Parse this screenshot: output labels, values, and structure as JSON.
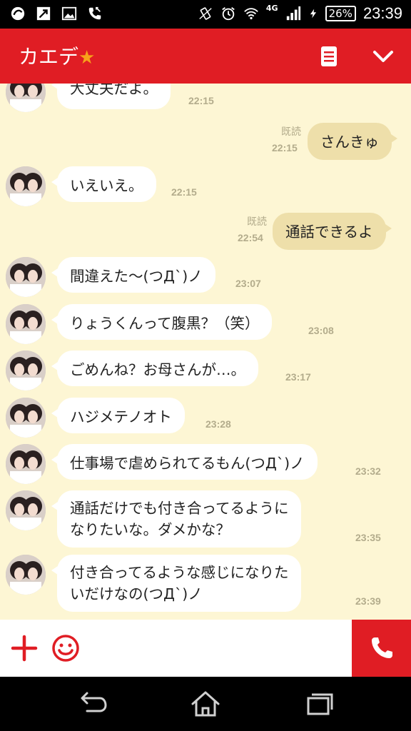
{
  "status_bar": {
    "network": "4G",
    "battery": "26%",
    "time": "23:39"
  },
  "header": {
    "contact_name": "カエデ",
    "star": "★",
    "icons": [
      "notes-icon",
      "chevron-down-icon"
    ]
  },
  "messages": [
    {
      "side": "in",
      "lines": [
        "大丈夫だよ。"
      ],
      "time": "22:15"
    },
    {
      "side": "out",
      "lines": [
        "さんきゅ"
      ],
      "read": "既読",
      "time": "22:15"
    },
    {
      "side": "in",
      "lines": [
        "いえいえ。"
      ],
      "time": "22:15"
    },
    {
      "side": "out",
      "lines": [
        "通話できるよ"
      ],
      "read": "既読",
      "time": "22:54"
    },
    {
      "side": "in",
      "lines": [
        "間違えた〜(つД`)ノ"
      ],
      "time": "23:07"
    },
    {
      "side": "in",
      "lines": [
        "りょうくんって腹黒？（笑）"
      ],
      "time": "23:08"
    },
    {
      "side": "in",
      "lines": [
        "ごめんね？お母さんが…。"
      ],
      "time": "23:17"
    },
    {
      "side": "in",
      "lines": [
        "ハジメテノオト"
      ],
      "time": "23:28"
    },
    {
      "side": "in",
      "lines": [
        "仕事場で虐められてるもん(つД`)ノ"
      ],
      "time": "23:32"
    },
    {
      "side": "in",
      "lines": [
        "通話だけでも付き合ってるように",
        "なりたいな。ダメかな？"
      ],
      "time": "23:35"
    },
    {
      "side": "in",
      "lines": [
        "付き合ってるような感じになりた",
        "いだけなの(つД`)ノ"
      ],
      "time": "23:39"
    }
  ],
  "input_bar": {
    "icons": [
      "plus-icon",
      "emoji-icon",
      "phone-icon"
    ]
  },
  "nav_bar": {
    "icons": [
      "back-icon",
      "home-icon",
      "recent-apps-icon"
    ]
  },
  "colors": {
    "accent": "#e01d24",
    "chat_background": "#fdf6d4",
    "incoming_bubble": "#ffffff",
    "outgoing_bubble": "#eedfaa",
    "meta_text": "#b3ac8c"
  }
}
